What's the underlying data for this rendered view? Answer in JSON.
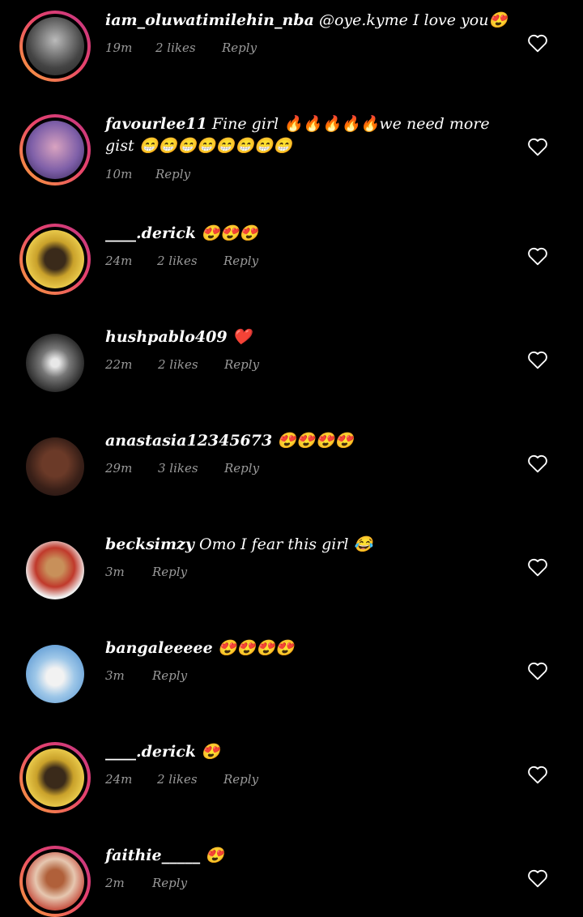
{
  "comments": [
    {
      "username": "iam_oluwatimilehin_nba",
      "text": "@oye.kyme I love you😍",
      "time": "19m",
      "likes": "2 likes",
      "reply": "Reply"
    },
    {
      "username": "favourlee11",
      "text": "Fine girl 🔥🔥🔥🔥🔥we need more gist 😁😁😁😁😁😁😁😁",
      "time": "10m",
      "likes": "",
      "reply": "Reply"
    },
    {
      "username": "____.derick",
      "text": "😍😍😍",
      "time": "24m",
      "likes": "2 likes",
      "reply": "Reply"
    },
    {
      "username": "hushpablo409",
      "text": "❤️",
      "time": "22m",
      "likes": "2 likes",
      "reply": "Reply"
    },
    {
      "username": "anastasia12345673",
      "text": "😍😍😍😍",
      "time": "29m",
      "likes": "3 likes",
      "reply": "Reply"
    },
    {
      "username": "becksimzy",
      "text": "Omo I fear this girl 😂",
      "time": "3m",
      "likes": "",
      "reply": "Reply"
    },
    {
      "username": "bangaleeeee",
      "text": "😍😍😍😍",
      "time": "3m",
      "likes": "",
      "reply": "Reply"
    },
    {
      "username": "____.derick",
      "text": "😍",
      "time": "24m",
      "likes": "2 likes",
      "reply": "Reply"
    },
    {
      "username": "faithie_____",
      "text": "😍",
      "time": "2m",
      "likes": "",
      "reply": "Reply"
    }
  ],
  "colors": {
    "background": "#000000",
    "meta": "#9a9a9a",
    "ring_start": "#f9a23a",
    "ring_end": "#c13584"
  },
  "icons": {
    "like": "heart-outline-icon"
  }
}
